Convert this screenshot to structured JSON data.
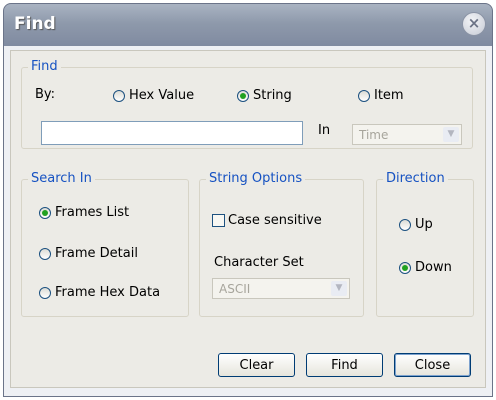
{
  "window": {
    "title": "Find",
    "close_glyph": "×"
  },
  "find_group": {
    "label": "Find",
    "by_label": "By:",
    "options": [
      {
        "label": "Hex Value",
        "selected": false
      },
      {
        "label": "String",
        "selected": true
      },
      {
        "label": "Item",
        "selected": false
      }
    ],
    "search_value": "",
    "in_label": "In",
    "in_select": {
      "value": "Time",
      "enabled": false
    }
  },
  "search_in": {
    "label": "Search In",
    "options": [
      {
        "label": "Frames List",
        "selected": true
      },
      {
        "label": "Frame Detail",
        "selected": false
      },
      {
        "label": "Frame Hex Data",
        "selected": false
      }
    ]
  },
  "string_options": {
    "label": "String Options",
    "case_sensitive": {
      "label": "Case sensitive",
      "checked": false
    },
    "charset_label": "Character Set",
    "charset_select": {
      "value": "ASCII",
      "enabled": false
    }
  },
  "direction": {
    "label": "Direction",
    "options": [
      {
        "label": "Up",
        "selected": false
      },
      {
        "label": "Down",
        "selected": true
      }
    ]
  },
  "buttons": {
    "clear": "Clear",
    "find": "Find",
    "close": "Close"
  }
}
